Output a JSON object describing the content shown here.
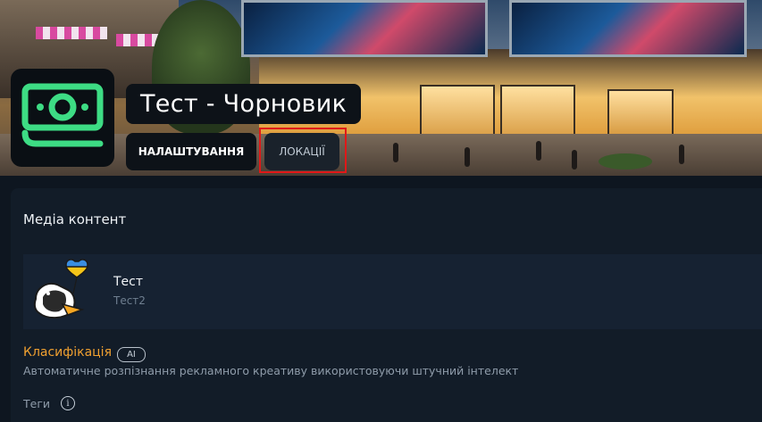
{
  "header": {
    "title": "Тест - Чорновик",
    "tabs": [
      {
        "label": "НАЛАШТУВАННЯ",
        "active": true
      },
      {
        "label": "ЛОКАЦІЇ",
        "active": false,
        "highlighted": true
      }
    ],
    "logo_icon": "money-bill-icon",
    "accent_color": "#3ddc84",
    "highlight_color": "#e01818"
  },
  "media": {
    "section_title": "Медіа контент",
    "items": [
      {
        "name": "Тест",
        "subtitle": "Тест2",
        "thumb_icon": "duck-with-balloon-icon"
      }
    ]
  },
  "classification": {
    "title": "Класифікація",
    "badge": "AI",
    "description": "Автоматичне розпізнання рекламного креативу використовуючи штучний інтелект",
    "title_color": "#f0a030"
  },
  "tags": {
    "label": "Теги",
    "icon": "info-icon"
  }
}
